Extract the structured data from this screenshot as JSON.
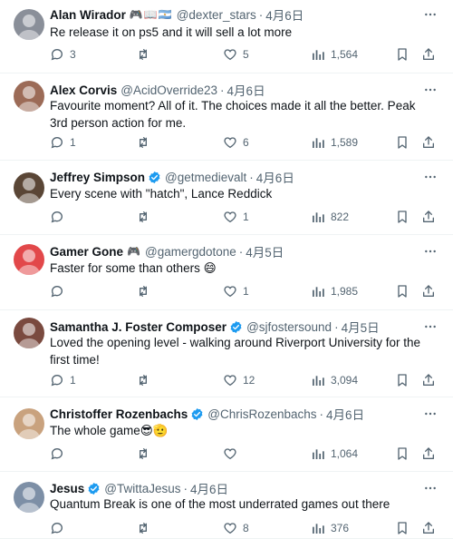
{
  "replies": [
    {
      "name": "Alan Wirador",
      "badges": "🎮📖🇦🇷",
      "verified": false,
      "handle": "@dexter_stars",
      "time": "4月6日",
      "text": "Re release it on ps5 and it will sell a lot more",
      "replies": "3",
      "reposts": "",
      "likes": "5",
      "views": "1,564",
      "avatar_color": "#8a8f99"
    },
    {
      "name": "Alex Corvis",
      "badges": "",
      "verified": false,
      "handle": "@AcidOverride23",
      "time": "4月6日",
      "text": "Favourite moment? All of it. The choices made it all the better. Peak 3rd person action for me.",
      "replies": "1",
      "reposts": "",
      "likes": "6",
      "views": "1,589",
      "avatar_color": "#9c6b57"
    },
    {
      "name": "Jeffrey Simpson",
      "badges": "",
      "verified": true,
      "handle": "@getmedievalt",
      "time": "4月6日",
      "text": "Every scene with \"hatch\", Lance Reddick",
      "replies": "",
      "reposts": "",
      "likes": "1",
      "views": "822",
      "avatar_color": "#5a4636"
    },
    {
      "name": "Gamer Gone",
      "badges": "🎮",
      "verified": false,
      "handle": "@gamergdotone",
      "time": "4月5日",
      "text": "Faster for some than others 😄",
      "replies": "",
      "reposts": "",
      "likes": "1",
      "views": "1,985",
      "avatar_color": "#e2484a"
    },
    {
      "name": "Samantha J. Foster Composer",
      "badges": "",
      "verified": true,
      "handle": "@sjfostersound",
      "time": "4月5日",
      "text": "Loved the opening level - walking around Riverport University for the first time!",
      "replies": "1",
      "reposts": "",
      "likes": "12",
      "views": "3,094",
      "avatar_color": "#7a4a3f"
    },
    {
      "name": "Christoffer Rozenbachs",
      "badges": "",
      "verified": true,
      "handle": "@ChrisRozenbachs",
      "time": "4月6日",
      "text": "The whole game😎🫡",
      "replies": "",
      "reposts": "",
      "likes": "",
      "views": "1,064",
      "avatar_color": "#c9a27e"
    },
    {
      "name": "Jesus",
      "badges": "",
      "verified": true,
      "handle": "@TwittaJesus",
      "time": "4月6日",
      "text": "Quantum Break is one of the most underrated games out there",
      "replies": "",
      "reposts": "",
      "likes": "8",
      "views": "376",
      "avatar_color": "#7d8fa6"
    }
  ],
  "colors": {
    "verified": "#1d9bf0",
    "muted": "#536471",
    "text": "#0f1419",
    "divider": "#eff3f4"
  }
}
